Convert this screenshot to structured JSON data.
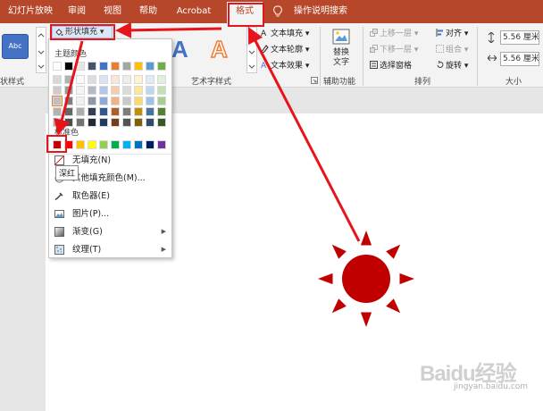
{
  "tabs": [
    {
      "label": "幻灯片放映",
      "active": false
    },
    {
      "label": "审阅",
      "active": false
    },
    {
      "label": "视图",
      "active": false
    },
    {
      "label": "帮助",
      "active": false
    },
    {
      "label": "Acrobat",
      "active": false
    },
    {
      "label": "格式",
      "active": true
    },
    {
      "label": "操作说明搜索",
      "active": false
    }
  ],
  "ribbon": {
    "shape_style_sample": "Abc",
    "shape_fill_button": "形状填充",
    "wordart_letter": "A",
    "text_fill": "文本填充",
    "text_outline": "文本轮廓",
    "text_effects": "文本效果",
    "alt_text_line1": "替换",
    "alt_text_line2": "文字",
    "bring_forward": "上移一层",
    "send_backward": "下移一层",
    "selection_pane": "选择窗格",
    "align": "对齐",
    "group": "组合",
    "rotate": "旋转",
    "height_value": "5.56 厘米",
    "width_value": "5.56 厘米",
    "group_labels": {
      "shape_styles": "状样式",
      "wordart": "艺术字样式",
      "accessibility": "辅助功能",
      "arrange": "排列",
      "size": "大小"
    }
  },
  "dropdown": {
    "theme_colors_label": "主题颜色",
    "standard_colors_label": "标准色",
    "tooltip": "深红",
    "theme_top_row": [
      "#ffffff",
      "#000000",
      "#e7e6e6",
      "#44546a",
      "#4472c4",
      "#ed7d31",
      "#a5a5a5",
      "#ffc000",
      "#5b9bd5",
      "#70ad47"
    ],
    "standard_colors": [
      "#c00000",
      "#ff0000",
      "#ffc000",
      "#ffff00",
      "#92d050",
      "#00b050",
      "#00b0f0",
      "#0070c0",
      "#002060",
      "#7030a0"
    ],
    "items": [
      {
        "label": "无填充(N)",
        "icon": "no-fill-icon",
        "submenu": false
      },
      {
        "label": "其他填充颜色(M)...",
        "icon": "palette-icon",
        "submenu": false
      },
      {
        "label": "取色器(E)",
        "icon": "eyedropper-icon",
        "submenu": false
      },
      {
        "label": "图片(P)...",
        "icon": "picture-icon",
        "submenu": false
      },
      {
        "label": "渐变(G)",
        "icon": "gradient-icon",
        "submenu": true
      },
      {
        "label": "纹理(T)",
        "icon": "texture-icon",
        "submenu": true
      }
    ]
  },
  "slide": {
    "sun_color": "#c00000"
  },
  "watermark": {
    "brand": "Baidu经验",
    "url": "jingyan.baidu.com"
  }
}
